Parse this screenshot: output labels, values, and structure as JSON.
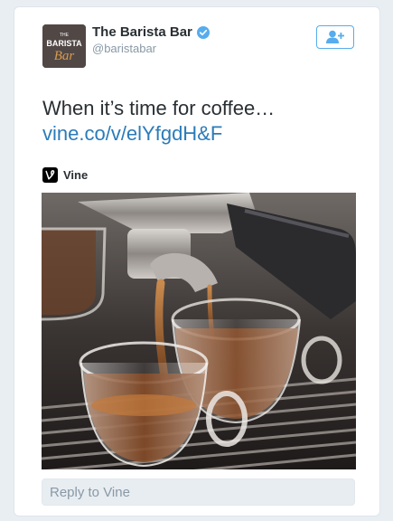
{
  "tweet": {
    "author_name": "The Barista Bar",
    "author_handle": "@baristabar",
    "text": "When it’s time for coffee…",
    "link": "vine.co/v/elYfgdH&F",
    "verified": true
  },
  "avatar": {
    "logo_text_top": "THE",
    "logo_text_mid": "BARISTA",
    "logo_text_script": "Bar"
  },
  "source": {
    "label": "Vine",
    "icon": "vine-icon"
  },
  "media": {
    "description_icon": "espresso-video"
  },
  "reply": {
    "placeholder": "Reply to Vine"
  },
  "colors": {
    "accent": "#55acee",
    "link": "#2b7bb9",
    "text": "#292f33",
    "muted": "#8899a6"
  }
}
